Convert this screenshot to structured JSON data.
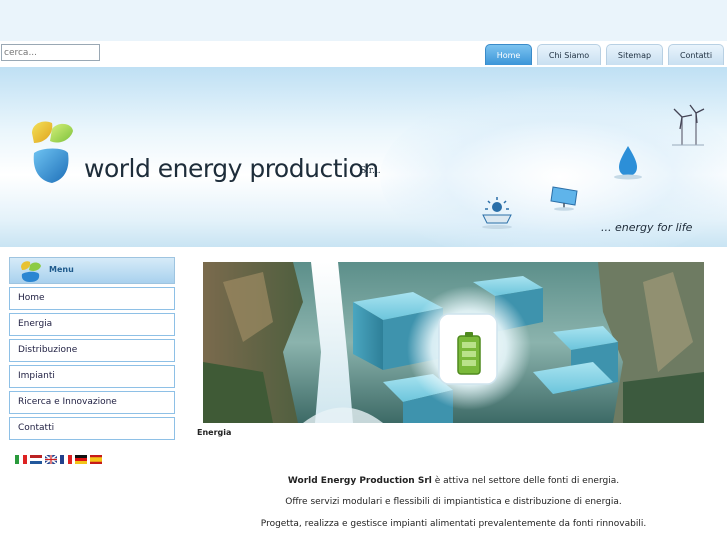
{
  "search": {
    "placeholder": "cerca..."
  },
  "nav_tabs": [
    {
      "label": "Home",
      "active": true
    },
    {
      "label": "Chi Siamo",
      "active": false
    },
    {
      "label": "Sitemap",
      "active": false
    },
    {
      "label": "Contatti",
      "active": false
    }
  ],
  "header": {
    "brand": "world energy production",
    "brand_suffix": "S.r.l.",
    "tagline": "... energy for life",
    "icons": [
      "wind-turbine-icon",
      "water-drop-icon",
      "solar-panel-icon",
      "sun-panel-icon"
    ]
  },
  "menu": {
    "title": "Menu",
    "items": [
      "Home",
      "Energia",
      "Distribuzione",
      "Impianti",
      "Ricerca e Innovazione",
      "Contatti"
    ]
  },
  "languages": [
    "it",
    "nl",
    "en",
    "fr",
    "de",
    "es"
  ],
  "banner": {
    "caption": "Energia",
    "icon": "battery-icon"
  },
  "content": {
    "company": "World Energy Production Srl",
    "line1_rest": " è attiva nel settore delle fonti di energia.",
    "line2": "Offre servizi modulari e flessibili di impiantistica e distribuzione di energia.",
    "line3": "Progetta, realizza e gestisce impianti alimentati prevalentemente da fonti rinnovabili."
  },
  "colors": {
    "accent": "#3b95d8",
    "menu_border": "#8ec0e6",
    "logo_green": "#7cc13b",
    "logo_blue": "#1e6fb8"
  }
}
